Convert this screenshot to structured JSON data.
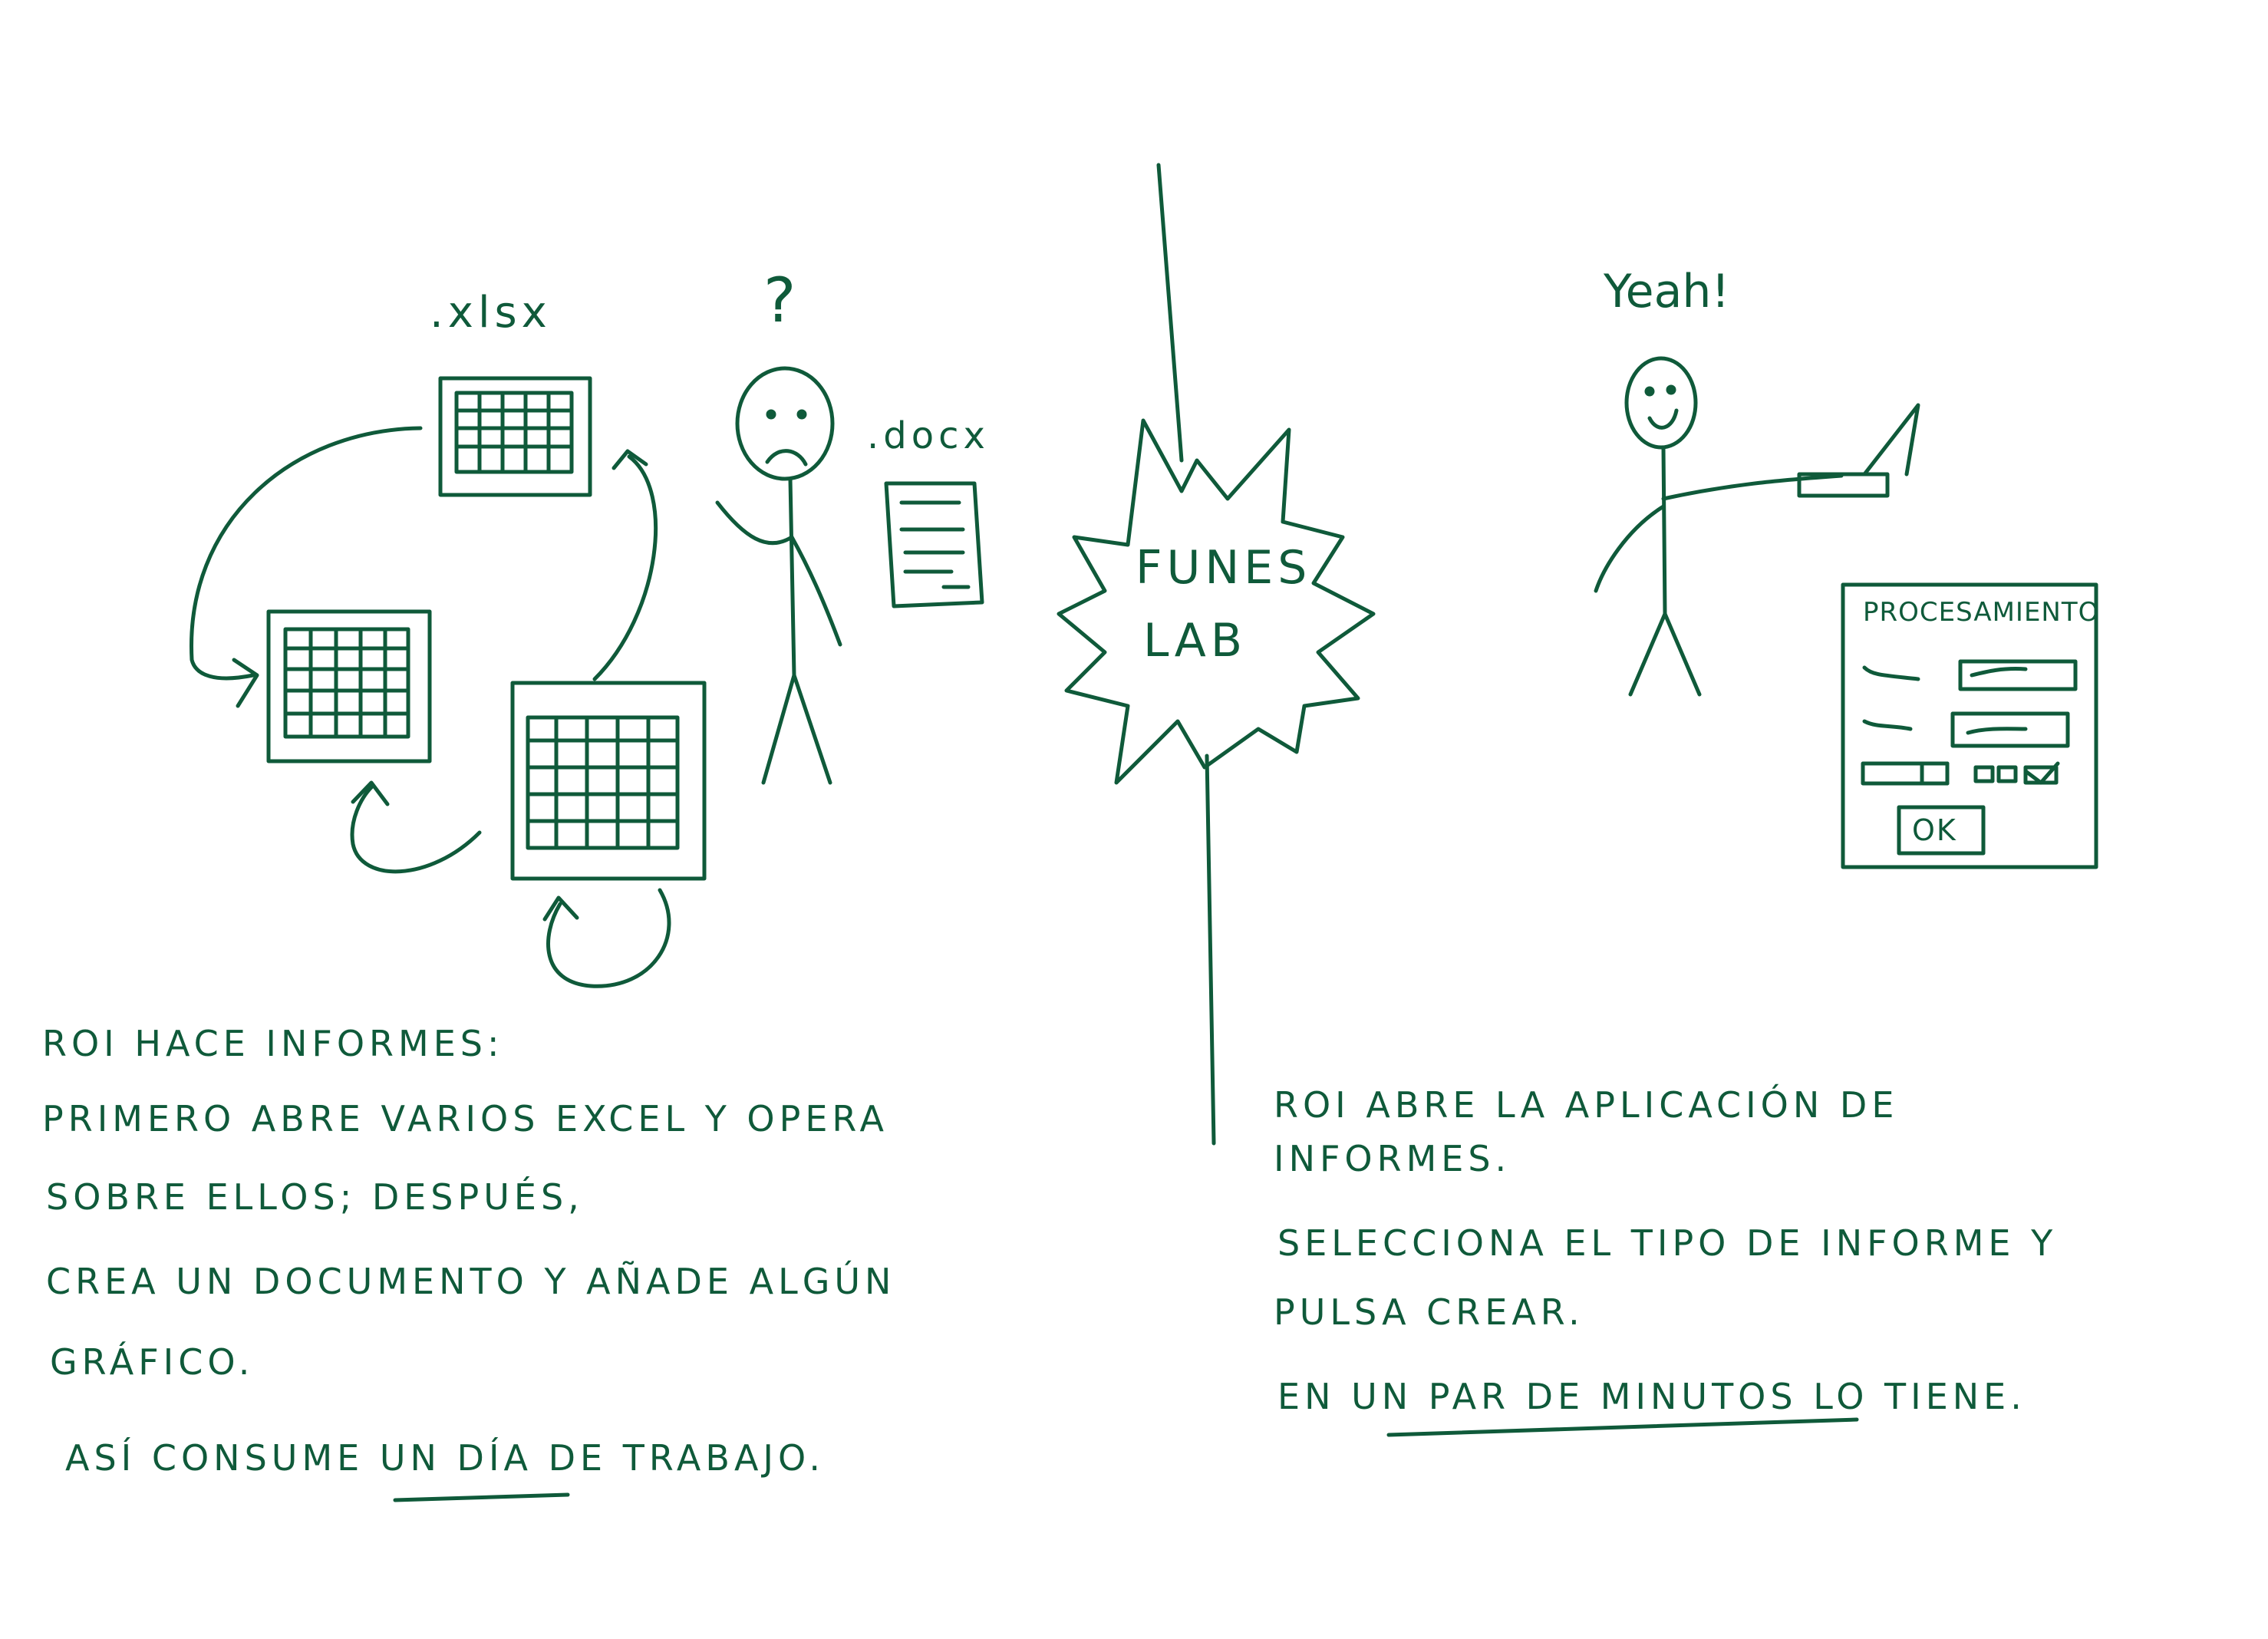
{
  "left_panel": {
    "xlsx_label": ".xlsx",
    "question_mark": "?",
    "docx_label": ".docx",
    "caption_lines": [
      "ROI HACE INFORMES:",
      "PRIMERO ABRE VARIOS EXCEL Y OPERA",
      "SOBRE ELLOS; DESPUÉS,",
      "CREA UN DOCUMENTO Y AÑADE ALGÚN",
      "GRÁFICO.",
      "ASÍ CONSUME UN DÍA DE TRABAJO."
    ]
  },
  "center": {
    "logo_line1": "FUNES",
    "logo_line2": "LAB"
  },
  "right_panel": {
    "exclamation": "Yeah!",
    "dialog_title": "PROCESAMIENTO",
    "ok_button": "OK",
    "caption_lines": [
      "ROI ABRE LA APLICACIÓN DE",
      "INFORMES.",
      "SELECCIONA EL TIPO DE INFORME Y",
      "PULSA CREAR.",
      "EN UN PAR DE MINUTOS LO TIENE."
    ]
  },
  "colors": {
    "ink": "#0f5a3a",
    "paper": "#ffffff"
  }
}
